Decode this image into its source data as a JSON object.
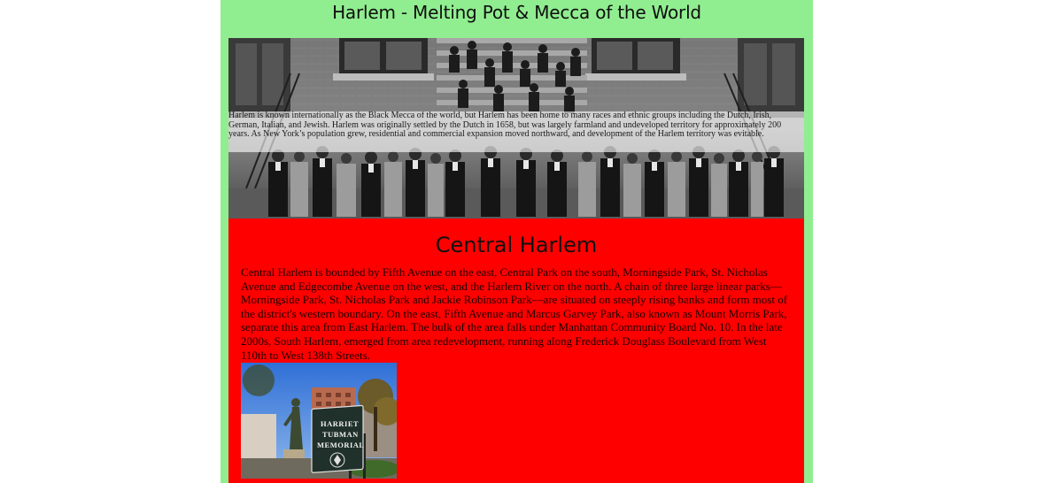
{
  "header": {
    "title": "Harlem - Melting Pot & Mecca of the World"
  },
  "hero": {
    "text": "Harlem is known internationally as the Black Mecca of the world, but Harlem has been home to many races and ethnic groups including the Dutch, Irish, German, Italian, and Jewish. Harlem was originally settled by the Dutch in 1658, but was largely farmland and undeveloped territory for approximately 200 years. As New York’s population grew, residential and commercial expansion moved northward, and development of the Harlem territory was evitable."
  },
  "central_harlem": {
    "heading": "Central Harlem",
    "body": "Central Harlem is bounded by Fifth Avenue on the east, Central Park on the south, Morningside Park, St. Nicholas Avenue and Edgecombe Avenue on the west, and the Harlem River on the north. A chain of three large linear parks—Morningside Park, St. Nicholas Park and Jackie Robinson Park—are situated on steeply rising banks and form most of the district's western boundary. On the east, Fifth Avenue and Marcus Garvey Park, also known as Mount Morris Park, separate this area from East Harlem. The bulk of the area falls under Manhattan Community Board No. 10. In the late 2000s, South Harlem, emerged from area redevelopment, running along Frederick Douglass Boulevard from West 110th to West 138th Streets.",
    "photo": {
      "sign_line_1": "HARRIET",
      "sign_line_2": "TUBMAN",
      "sign_line_3": "MEMORIAL"
    }
  },
  "colors": {
    "page_background": "#90ee90",
    "section_background": "#ff0000"
  }
}
